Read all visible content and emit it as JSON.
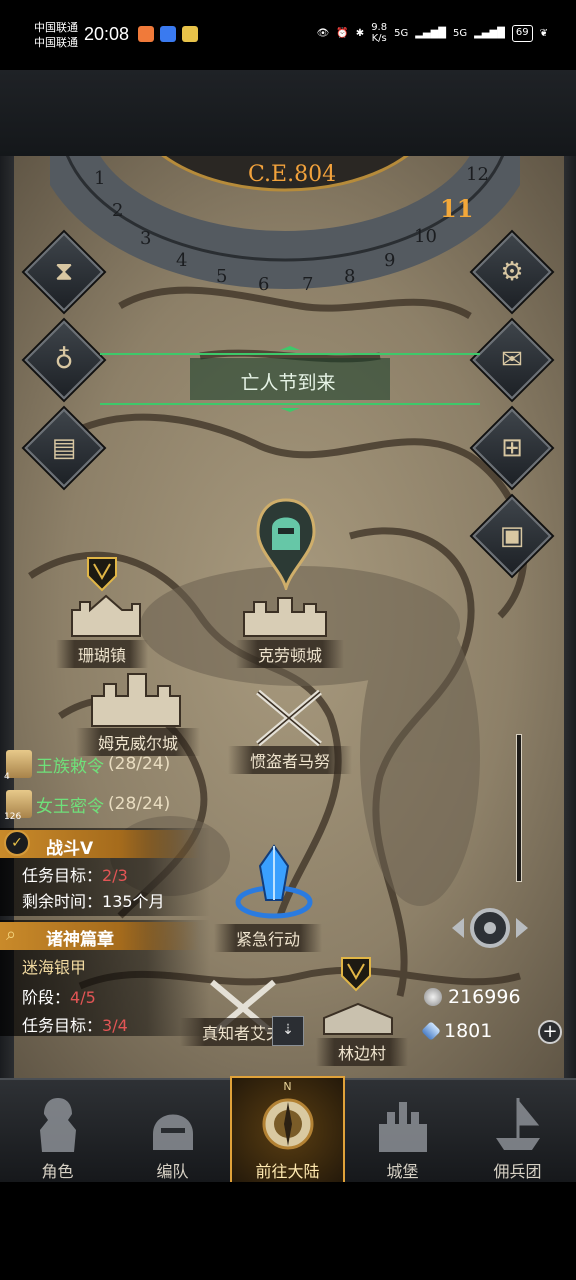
{
  "status_bar": {
    "carrier_1": "中国联通",
    "carrier_2": "中国联通",
    "time": "20:08",
    "net_speed": "9.8\nK/s",
    "signal_1": "5G",
    "signal_2": "5G",
    "battery": "69"
  },
  "calendar": {
    "era": "C.E.804",
    "months": [
      "1",
      "2",
      "3",
      "4",
      "5",
      "6",
      "7",
      "8",
      "9",
      "10",
      "11",
      "12"
    ],
    "current_month": "11"
  },
  "event_banner": "亡人节到来",
  "side_buttons_left": [
    "hourglass-icon",
    "coin-pouch-icon",
    "scroll-map-icon"
  ],
  "side_buttons_right": [
    "settings-gear-icon",
    "mail-icon",
    "guild-board-icon",
    "supplies-icon"
  ],
  "map_locations": {
    "coral_town": "珊瑚镇",
    "kraughton": "克劳顿城",
    "mkwell": "姆克威尔城",
    "thief_manu": "惯盗者马努",
    "emergency": "紧急行动",
    "true_knower": "真知者艾夫",
    "forest_village": "林边村"
  },
  "orders": [
    {
      "count": "4",
      "label": "王族敕令",
      "progress": "(28/24)"
    },
    {
      "count": "126",
      "label": "女王密令",
      "progress": "(28/24)"
    }
  ],
  "battle_task": {
    "title": "战斗V",
    "goal_label": "任务目标：",
    "goal_value": "2/3",
    "time_label": "剩余时间：",
    "time_value": "135个月"
  },
  "story_task": {
    "title": "诸神篇章",
    "subtitle": "迷海银甲",
    "stage_label": "阶段：",
    "stage_value": "4/5",
    "goal_label": "任务目标：",
    "goal_value": "3/4"
  },
  "resources": {
    "silver": "216996",
    "crystal": "1801"
  },
  "bottom_nav": [
    {
      "label": "角色",
      "icon": "knight-icon"
    },
    {
      "label": "编队",
      "icon": "helmet-icon"
    },
    {
      "label": "前往大陆",
      "icon": "compass-icon",
      "active": true,
      "compass_letter": "N"
    },
    {
      "label": "城堡",
      "icon": "castle-icon"
    },
    {
      "label": "佣兵团",
      "icon": "ship-icon"
    }
  ],
  "colors": {
    "accent_gold": "#e0a23a",
    "progress_red": "#e25555",
    "banner_green": "#3ec86a"
  }
}
